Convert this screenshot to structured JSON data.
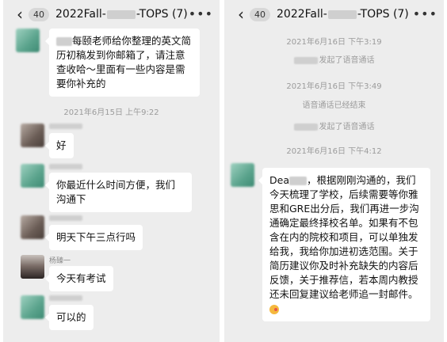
{
  "left_chat": {
    "back_icon": "chevron-left",
    "unread_count": "40",
    "title_prefix": "2022Fall-",
    "title_suffix": "-TOPS",
    "member_count": "(7)",
    "more_icon": "ellipsis",
    "messages": [
      {
        "text_parts": [
          "每颐老师给你整理的英文简历初稿发到你邮箱了，请注意查收哈～里面有一些内容是需要你补充的"
        ]
      },
      {
        "timestamp": "2021年6月15日 上午9:22"
      },
      {
        "text": "好"
      },
      {
        "text": "你最近什么时间方便，我们沟通下"
      },
      {
        "text": "明天下午三点行吗"
      },
      {
        "sender": "杨臻一",
        "text": "今天有考试"
      },
      {
        "text": "可以的"
      }
    ]
  },
  "right_chat": {
    "back_icon": "chevron-left",
    "unread_count": "40",
    "title_prefix": "2022Fall-",
    "title_suffix": "-TOPS",
    "member_count": "(7)",
    "more_icon": "ellipsis",
    "events": [
      {
        "timestamp": "2021年6月16日 下午3:19"
      },
      {
        "system": "发起了语音通话"
      },
      {
        "timestamp": "2021年6月16日 下午3:49"
      },
      {
        "system": "语音通话已经结束"
      },
      {
        "system": "发起了语音通话"
      },
      {
        "timestamp": "2021年6月16日 下午4:12"
      }
    ],
    "message": {
      "greeting": "Dea",
      "body": "，根据刚刚沟通的，我们今天梳理了学校，后续需要等你雅思和GRE出分后，我们再进一步沟通确定最终择校名单。如果有不包含在内的院校和项目，可以单独发给我，我给你加进初选范围。关于简历建议你及时补充缺失的内容后反馈，关于推荐信，若本周内教授还未回复建议给老师追一封邮件。",
      "emoji": "face-blowing-kiss"
    }
  }
}
